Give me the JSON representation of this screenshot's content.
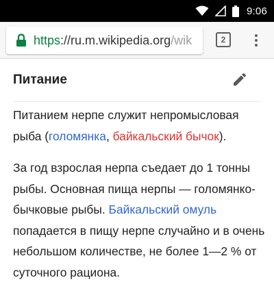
{
  "status_bar": {
    "time": "9:06",
    "icons": [
      "wifi-icon",
      "signal-icon",
      "battery-icon"
    ]
  },
  "browser": {
    "url_scheme": "https",
    "url_separator": "://",
    "url_host": "ru.m.wikipedia.org",
    "url_path": "/wik",
    "tab_count": "2",
    "colors": {
      "secure": "#0b8043",
      "toolbar": "#f7f7f7"
    }
  },
  "article": {
    "section_title": "Питание",
    "para1": {
      "text_before": "Питанием нерпе служит непромысловая рыба (",
      "link1": "голомянка",
      "separator": ", ",
      "link2": "байкальский бычок",
      "text_after": ")."
    },
    "para2": {
      "text_before": "За год взрослая нерпа съедает до 1 тонны рыбы. Основная пища нерпы — голомянко-бычковые рыбы. ",
      "link": "Байкальский омуль",
      "text_after": " попадается в пищу нерпе случайно и в очень небольшом количестве, не более 1—2 % от суточного рациона."
    },
    "colors": {
      "link": "#3366cc",
      "new_link": "#dd3333"
    }
  }
}
